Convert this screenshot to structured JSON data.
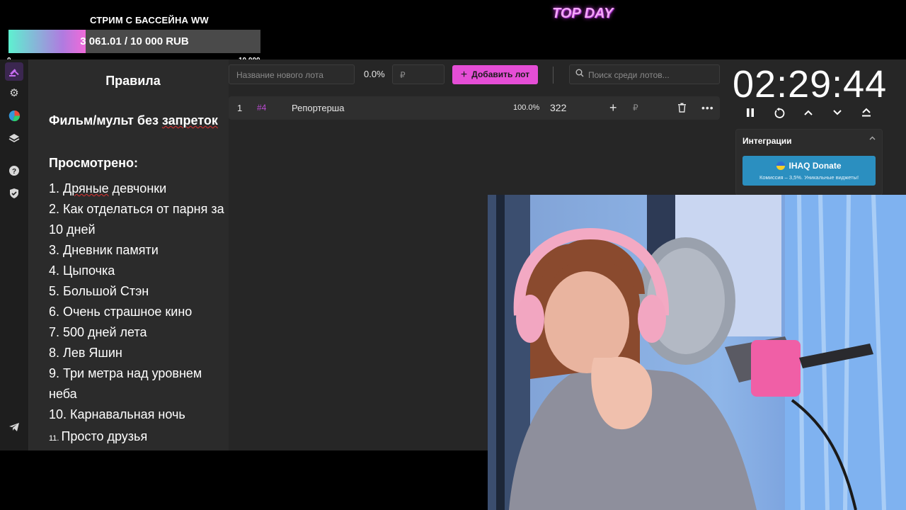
{
  "overlay": {
    "goal_title": "СТРИМ С БАССЕЙНА WW",
    "goal_text": "3 061.01 / 10 000 RUB",
    "goal_progress": 0.3061,
    "goal_min": "0",
    "goal_max": "10 000",
    "top_day": "TOP DAY"
  },
  "sidebar": {
    "items": [
      {
        "name": "auction",
        "icon": "gavel-icon"
      },
      {
        "name": "settings",
        "icon": "gear-icon"
      },
      {
        "name": "statistics",
        "icon": "pie-chart-icon"
      },
      {
        "name": "layers",
        "icon": "layers-icon"
      },
      {
        "name": "help",
        "icon": "help-icon"
      },
      {
        "name": "security",
        "icon": "shield-icon"
      },
      {
        "name": "telegram",
        "icon": "telegram-icon"
      }
    ]
  },
  "rules": {
    "title": "Правила",
    "genre": "Фильм/мульт без запреток",
    "watched_label": "Просмотрено:",
    "items": [
      "1. Дряные девчонки",
      "2. Как отделаться от парня за 10 дней",
      "3. Дневник памяти",
      "4. Цыпочка",
      "5. Большой Стэн",
      "6. Очень страшное кино",
      "7. 500 дней лета",
      "8. Лев Яшин",
      "9. Три метра над уровнем неба",
      "10. Карнавальная ночь"
    ],
    "last_num": "11.",
    "last_item": "Просто друзья"
  },
  "toolbar": {
    "lot_name_placeholder": "Название нового лота",
    "percent": "0.0%",
    "amount_placeholder": "₽",
    "add_lot_label": "Добавить лот",
    "search_placeholder": "Поиск среди лотов..."
  },
  "lots": [
    {
      "index": "1",
      "code": "#4",
      "title": "Репортерша",
      "percent": "100.0%",
      "amount": "322",
      "currency": "₽"
    }
  ],
  "timer": {
    "value": "02:29:44"
  },
  "integrations": {
    "title": "Интеграции",
    "donate_name": "IHAQ Donate",
    "donate_desc": "Комиссия – 3,5%. Уникальные виджеты!"
  },
  "colors": {
    "accent": "#e54ed6",
    "donate": "#2b8fc0",
    "goal_start": "#5ef0d0",
    "goal_end": "#f06ad9"
  }
}
